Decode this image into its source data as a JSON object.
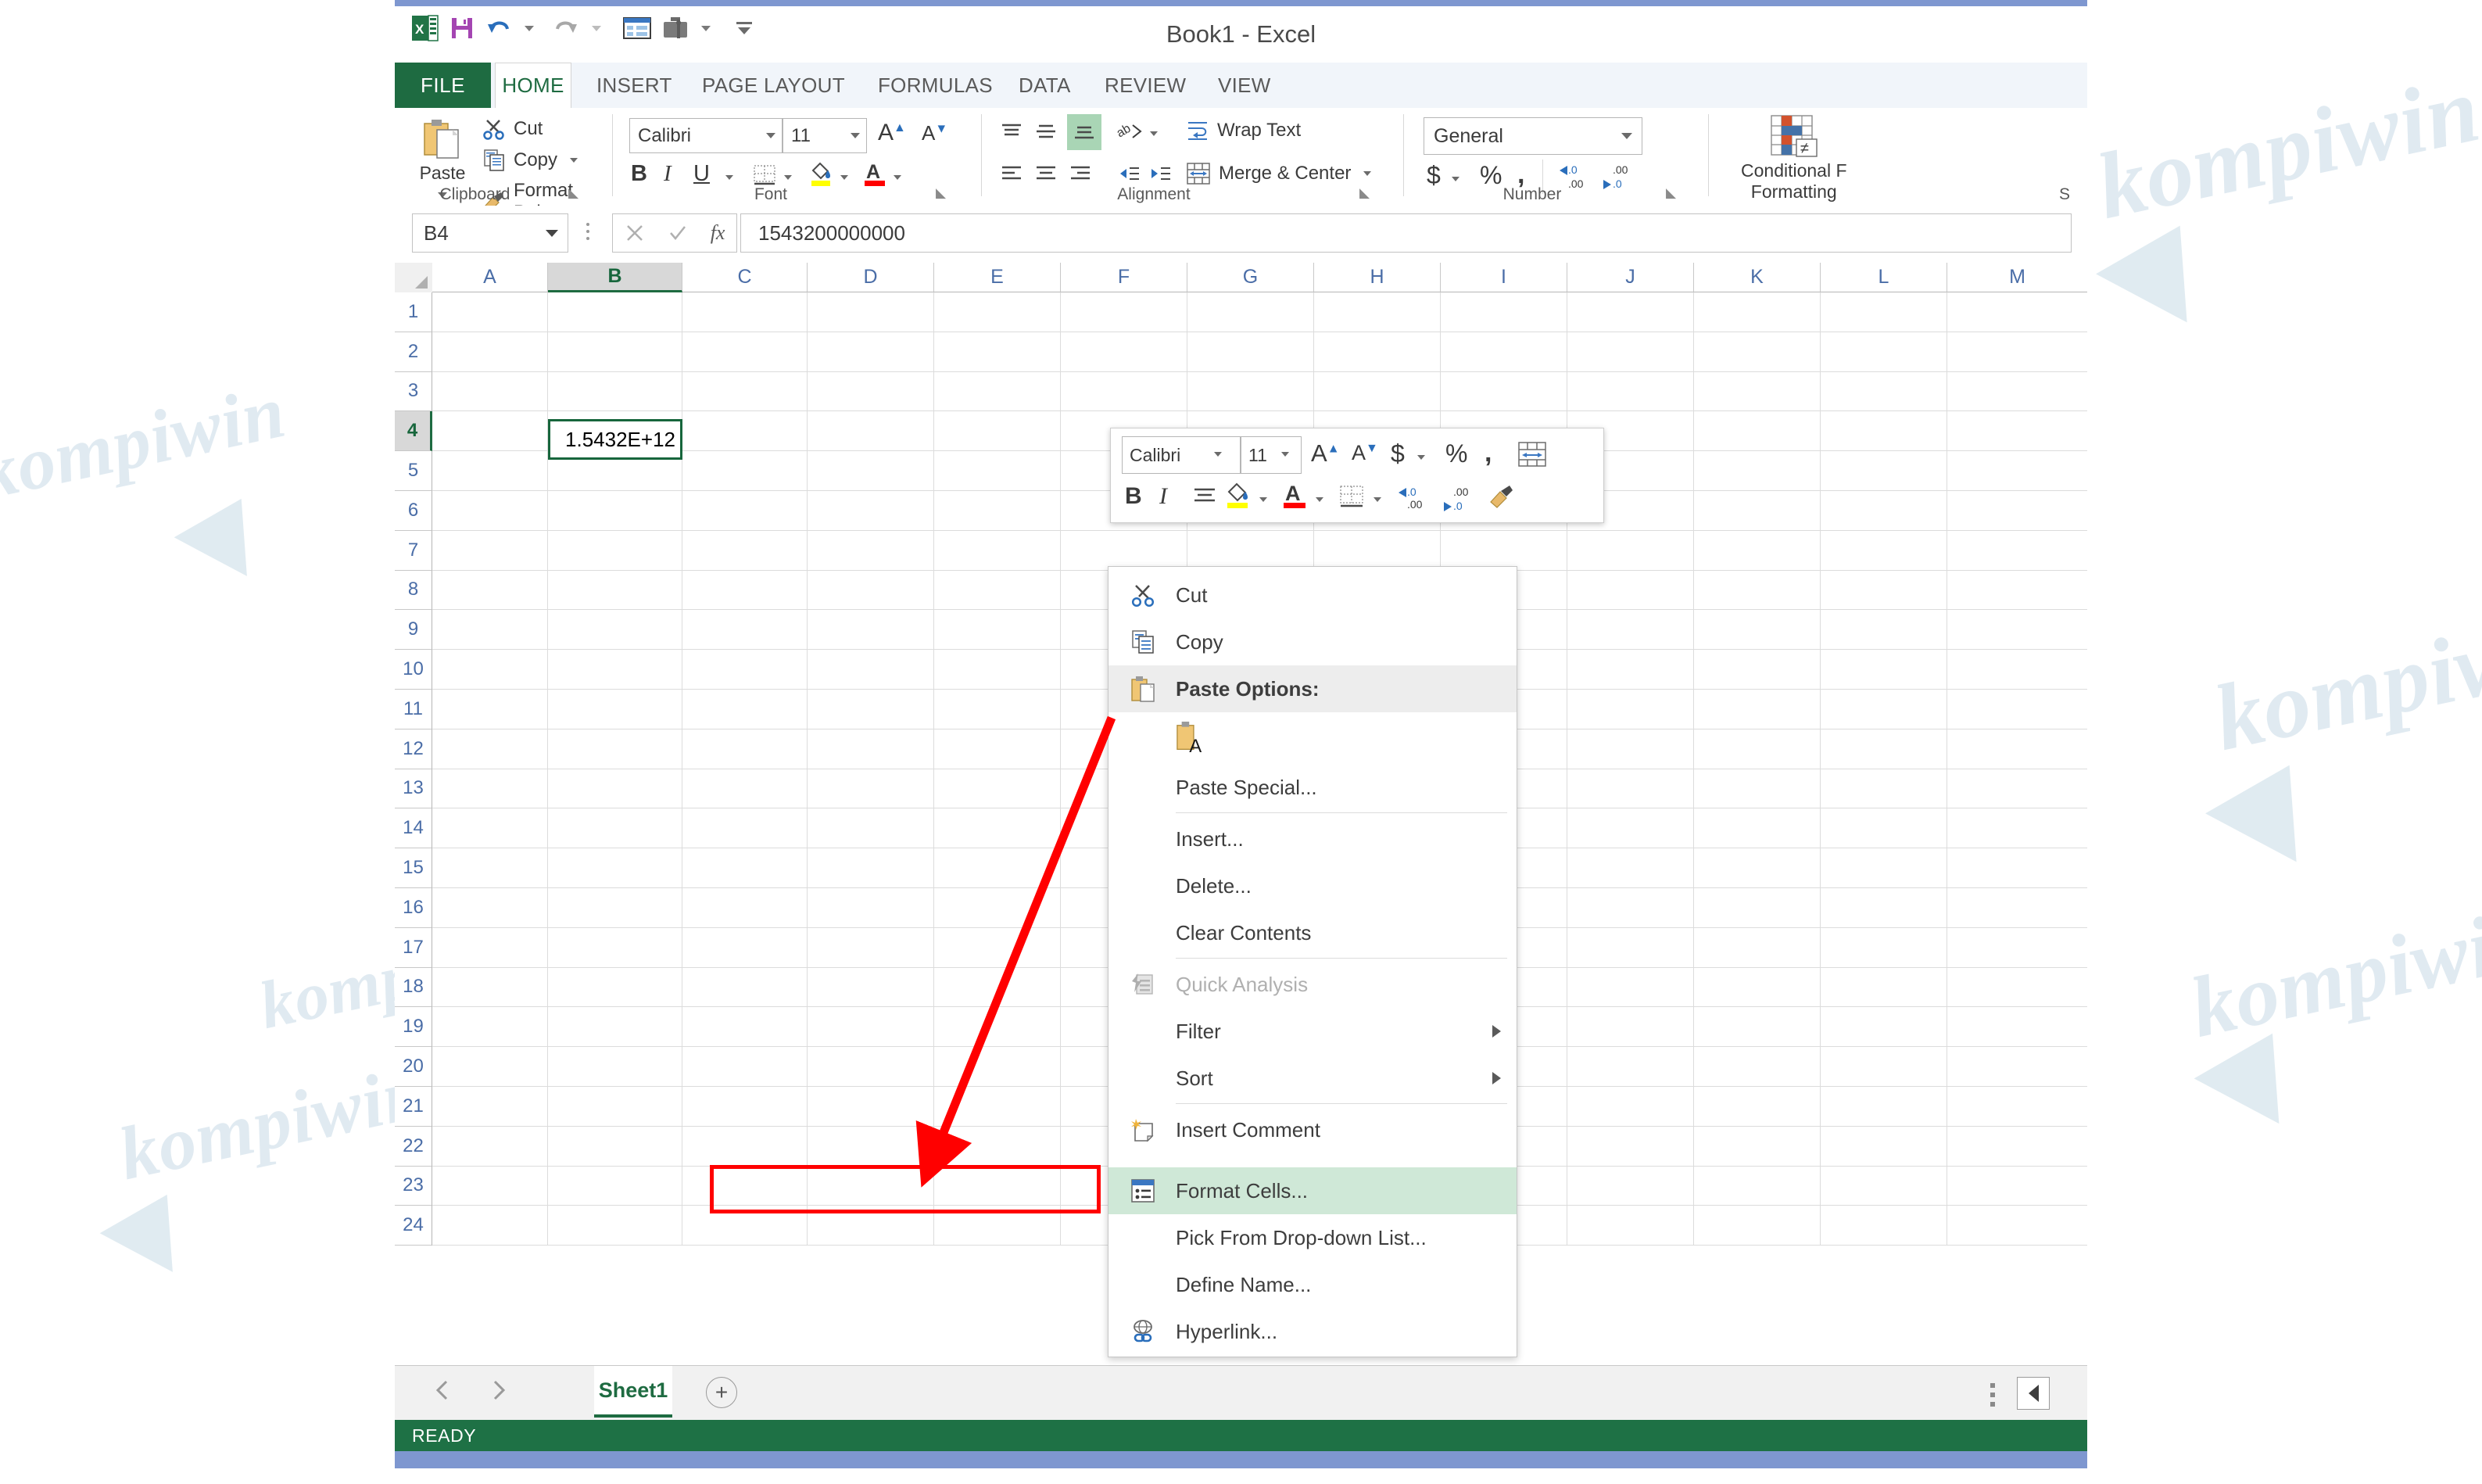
{
  "window": {
    "title": "Book1 - Excel",
    "quick_access": [
      "excel-logo",
      "save-icon",
      "undo-icon",
      "redo-icon",
      "touch-mode-icon",
      "customize-toolbar-icon",
      "more-icon"
    ]
  },
  "ribbon": {
    "tabs": [
      {
        "label": "FILE",
        "active": false
      },
      {
        "label": "HOME",
        "active": true
      },
      {
        "label": "INSERT",
        "active": false
      },
      {
        "label": "PAGE LAYOUT",
        "active": false
      },
      {
        "label": "FORMULAS",
        "active": false
      },
      {
        "label": "DATA",
        "active": false
      },
      {
        "label": "REVIEW",
        "active": false
      },
      {
        "label": "VIEW",
        "active": false
      }
    ],
    "groups": [
      {
        "name": "Clipboard"
      },
      {
        "name": "Font"
      },
      {
        "name": "Alignment"
      },
      {
        "name": "Number"
      },
      {
        "name": "S"
      }
    ],
    "clipboard": {
      "paste_label": "Paste",
      "cut_label": "Cut",
      "copy_label": "Copy",
      "format_painter_label": "Format Painter"
    },
    "font": {
      "family": "Calibri",
      "size": "11",
      "grow_label": "A",
      "shrink_label": "A",
      "bold_label": "B",
      "italic_label": "I",
      "underline_label": "U"
    },
    "alignment": {
      "wrap_text_label": "Wrap Text",
      "merge_center_label": "Merge & Center"
    },
    "number": {
      "format": "General",
      "currency_label": "$",
      "percent_label": "%",
      "comma_label": ","
    },
    "styles": {
      "conditional_formatting_label": "Conditional  F",
      "conditional_formatting_line2": "Formatting"
    }
  },
  "formula_bar": {
    "name_box": "B4",
    "cancel_icon": "close-icon",
    "enter_icon": "check-icon",
    "function_icon": "fx",
    "value": "1543200000000"
  },
  "grid": {
    "columns": [
      "A",
      "B",
      "C",
      "D",
      "E",
      "F",
      "G",
      "H",
      "I",
      "J",
      "K",
      "L",
      "M"
    ],
    "selected_column": "B",
    "rows": [
      "1",
      "2",
      "3",
      "4",
      "5",
      "6",
      "7",
      "8",
      "9",
      "10",
      "11",
      "12",
      "13",
      "14",
      "15",
      "16",
      "17",
      "18",
      "19",
      "20",
      "21",
      "22",
      "23",
      "24"
    ],
    "selected_row": "4",
    "active_cell": "B4",
    "active_cell_display": "1.5432E+12"
  },
  "mini_toolbar": {
    "font_family": "Calibri",
    "font_size": "11",
    "grow_label": "A",
    "shrink_label": "A",
    "currency_label": "$",
    "percent_label": "%",
    "comma_label": ",",
    "bold_label": "B",
    "italic_label": "I"
  },
  "context_menu": {
    "items": [
      {
        "label": "Cut",
        "icon": "scissors-icon",
        "accel": "t",
        "type": "item"
      },
      {
        "label": "Copy",
        "icon": "copy-icon",
        "accel": "C",
        "type": "item"
      },
      {
        "label": "Paste Options:",
        "icon": "clipboard-icon",
        "type": "header"
      },
      {
        "label": "",
        "icon": "paste-values-icon",
        "type": "gallery"
      },
      {
        "label": "Paste Special...",
        "icon": "",
        "accel": "S",
        "type": "item"
      },
      {
        "label": "Insert...",
        "icon": "",
        "accel": "I",
        "type": "item"
      },
      {
        "label": "Delete...",
        "icon": "",
        "accel": "D",
        "type": "item"
      },
      {
        "label": "Clear Contents",
        "icon": "",
        "accel": "n",
        "type": "item"
      },
      {
        "label": "Quick Analysis",
        "icon": "quick-analysis-icon",
        "accel": "Q",
        "type": "disabled"
      },
      {
        "label": "Filter",
        "icon": "",
        "accel": "e",
        "type": "submenu"
      },
      {
        "label": "Sort",
        "icon": "",
        "accel": "o",
        "type": "submenu"
      },
      {
        "label": "Insert Comment",
        "icon": "comment-icon",
        "accel": "m",
        "type": "item"
      },
      {
        "label": "Format Cells...",
        "icon": "format-cells-icon",
        "accel": "F",
        "type": "highlighted"
      },
      {
        "label": "Pick From Drop-down List...",
        "icon": "",
        "accel": "k",
        "type": "item"
      },
      {
        "label": "Define Name...",
        "icon": "",
        "accel": "a",
        "type": "item"
      },
      {
        "label": "Hyperlink...",
        "icon": "hyperlink-icon",
        "accel": "i",
        "type": "item"
      }
    ]
  },
  "sheet_bar": {
    "sheet_name": "Sheet1",
    "add_sheet_label": "+",
    "prev_icon": "left-arrow-icon",
    "next_icon": "right-arrow-icon"
  },
  "status_bar": {
    "status": "READY"
  },
  "annotation": {
    "highlight_color": "#ff0000",
    "highlight_target": "Format Cells...",
    "arrow_color": "#ff0000"
  },
  "watermark": {
    "text": "kompiwin",
    "color": "#dbe7ef"
  }
}
